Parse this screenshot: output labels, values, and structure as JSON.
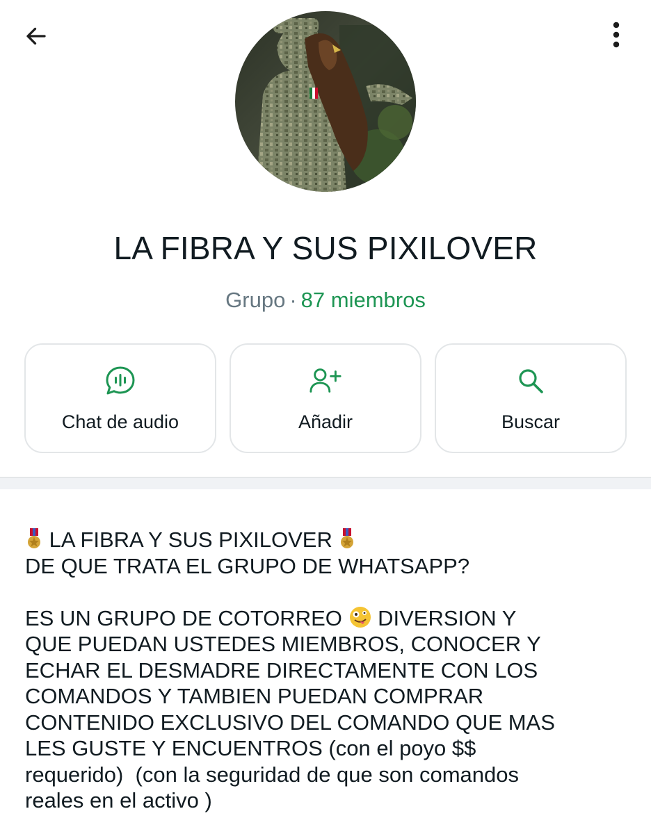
{
  "header": {
    "back_icon": "arrow-left-icon",
    "menu_icon": "more-vertical-icon"
  },
  "group": {
    "name": "LA FIBRA Y SUS PIXILOVER",
    "kind": "Grupo",
    "separator": "·",
    "members": "87 miembros"
  },
  "actions": [
    {
      "label": "Chat de audio",
      "icon": "audio-chat-icon"
    },
    {
      "label": "Añadir",
      "icon": "add-person-icon"
    },
    {
      "label": "Buscar",
      "icon": "search-icon"
    }
  ],
  "description": {
    "line1": "LA FIBRA Y SUS PIXILOVER",
    "line2": "DE QUE TRATA EL GRUPO DE WHATSAPP?",
    "para_a": "ES UN GRUPO DE COTORREO",
    "para_b": "DIVERSION Y\nQUE PUEDAN USTEDES MIEMBROS, CONOCER Y\nECHAR EL DESMADRE DIRECTAMENTE CON LOS\nCOMANDOS Y TAMBIEN PUEDAN COMPRAR\nCONTENIDO EXCLUSIVO DEL COMANDO QUE MAS\nLES GUSTE Y ENCUENTROS (con el poyo $$\nrequerido)  (con la seguridad de que son comandos\nreales en el activo )"
  },
  "colors": {
    "accent": "#1d9553",
    "muted": "#667781",
    "text": "#111b21",
    "border": "#e3e6e8"
  }
}
